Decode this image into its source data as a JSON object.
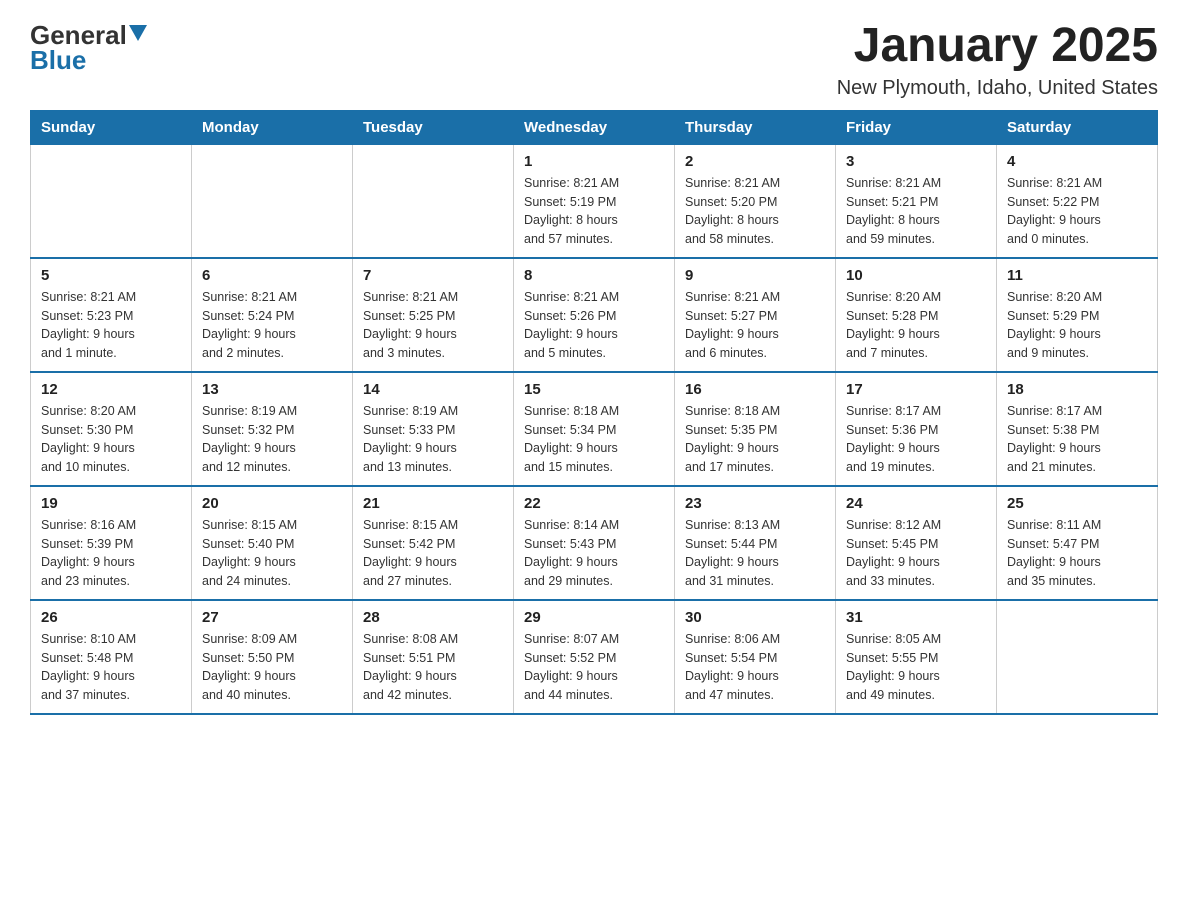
{
  "logo": {
    "general": "General",
    "blue": "Blue"
  },
  "title": "January 2025",
  "subtitle": "New Plymouth, Idaho, United States",
  "days_of_week": [
    "Sunday",
    "Monday",
    "Tuesday",
    "Wednesday",
    "Thursday",
    "Friday",
    "Saturday"
  ],
  "weeks": [
    [
      {
        "day": "",
        "info": ""
      },
      {
        "day": "",
        "info": ""
      },
      {
        "day": "",
        "info": ""
      },
      {
        "day": "1",
        "info": "Sunrise: 8:21 AM\nSunset: 5:19 PM\nDaylight: 8 hours\nand 57 minutes."
      },
      {
        "day": "2",
        "info": "Sunrise: 8:21 AM\nSunset: 5:20 PM\nDaylight: 8 hours\nand 58 minutes."
      },
      {
        "day": "3",
        "info": "Sunrise: 8:21 AM\nSunset: 5:21 PM\nDaylight: 8 hours\nand 59 minutes."
      },
      {
        "day": "4",
        "info": "Sunrise: 8:21 AM\nSunset: 5:22 PM\nDaylight: 9 hours\nand 0 minutes."
      }
    ],
    [
      {
        "day": "5",
        "info": "Sunrise: 8:21 AM\nSunset: 5:23 PM\nDaylight: 9 hours\nand 1 minute."
      },
      {
        "day": "6",
        "info": "Sunrise: 8:21 AM\nSunset: 5:24 PM\nDaylight: 9 hours\nand 2 minutes."
      },
      {
        "day": "7",
        "info": "Sunrise: 8:21 AM\nSunset: 5:25 PM\nDaylight: 9 hours\nand 3 minutes."
      },
      {
        "day": "8",
        "info": "Sunrise: 8:21 AM\nSunset: 5:26 PM\nDaylight: 9 hours\nand 5 minutes."
      },
      {
        "day": "9",
        "info": "Sunrise: 8:21 AM\nSunset: 5:27 PM\nDaylight: 9 hours\nand 6 minutes."
      },
      {
        "day": "10",
        "info": "Sunrise: 8:20 AM\nSunset: 5:28 PM\nDaylight: 9 hours\nand 7 minutes."
      },
      {
        "day": "11",
        "info": "Sunrise: 8:20 AM\nSunset: 5:29 PM\nDaylight: 9 hours\nand 9 minutes."
      }
    ],
    [
      {
        "day": "12",
        "info": "Sunrise: 8:20 AM\nSunset: 5:30 PM\nDaylight: 9 hours\nand 10 minutes."
      },
      {
        "day": "13",
        "info": "Sunrise: 8:19 AM\nSunset: 5:32 PM\nDaylight: 9 hours\nand 12 minutes."
      },
      {
        "day": "14",
        "info": "Sunrise: 8:19 AM\nSunset: 5:33 PM\nDaylight: 9 hours\nand 13 minutes."
      },
      {
        "day": "15",
        "info": "Sunrise: 8:18 AM\nSunset: 5:34 PM\nDaylight: 9 hours\nand 15 minutes."
      },
      {
        "day": "16",
        "info": "Sunrise: 8:18 AM\nSunset: 5:35 PM\nDaylight: 9 hours\nand 17 minutes."
      },
      {
        "day": "17",
        "info": "Sunrise: 8:17 AM\nSunset: 5:36 PM\nDaylight: 9 hours\nand 19 minutes."
      },
      {
        "day": "18",
        "info": "Sunrise: 8:17 AM\nSunset: 5:38 PM\nDaylight: 9 hours\nand 21 minutes."
      }
    ],
    [
      {
        "day": "19",
        "info": "Sunrise: 8:16 AM\nSunset: 5:39 PM\nDaylight: 9 hours\nand 23 minutes."
      },
      {
        "day": "20",
        "info": "Sunrise: 8:15 AM\nSunset: 5:40 PM\nDaylight: 9 hours\nand 24 minutes."
      },
      {
        "day": "21",
        "info": "Sunrise: 8:15 AM\nSunset: 5:42 PM\nDaylight: 9 hours\nand 27 minutes."
      },
      {
        "day": "22",
        "info": "Sunrise: 8:14 AM\nSunset: 5:43 PM\nDaylight: 9 hours\nand 29 minutes."
      },
      {
        "day": "23",
        "info": "Sunrise: 8:13 AM\nSunset: 5:44 PM\nDaylight: 9 hours\nand 31 minutes."
      },
      {
        "day": "24",
        "info": "Sunrise: 8:12 AM\nSunset: 5:45 PM\nDaylight: 9 hours\nand 33 minutes."
      },
      {
        "day": "25",
        "info": "Sunrise: 8:11 AM\nSunset: 5:47 PM\nDaylight: 9 hours\nand 35 minutes."
      }
    ],
    [
      {
        "day": "26",
        "info": "Sunrise: 8:10 AM\nSunset: 5:48 PM\nDaylight: 9 hours\nand 37 minutes."
      },
      {
        "day": "27",
        "info": "Sunrise: 8:09 AM\nSunset: 5:50 PM\nDaylight: 9 hours\nand 40 minutes."
      },
      {
        "day": "28",
        "info": "Sunrise: 8:08 AM\nSunset: 5:51 PM\nDaylight: 9 hours\nand 42 minutes."
      },
      {
        "day": "29",
        "info": "Sunrise: 8:07 AM\nSunset: 5:52 PM\nDaylight: 9 hours\nand 44 minutes."
      },
      {
        "day": "30",
        "info": "Sunrise: 8:06 AM\nSunset: 5:54 PM\nDaylight: 9 hours\nand 47 minutes."
      },
      {
        "day": "31",
        "info": "Sunrise: 8:05 AM\nSunset: 5:55 PM\nDaylight: 9 hours\nand 49 minutes."
      },
      {
        "day": "",
        "info": ""
      }
    ]
  ]
}
